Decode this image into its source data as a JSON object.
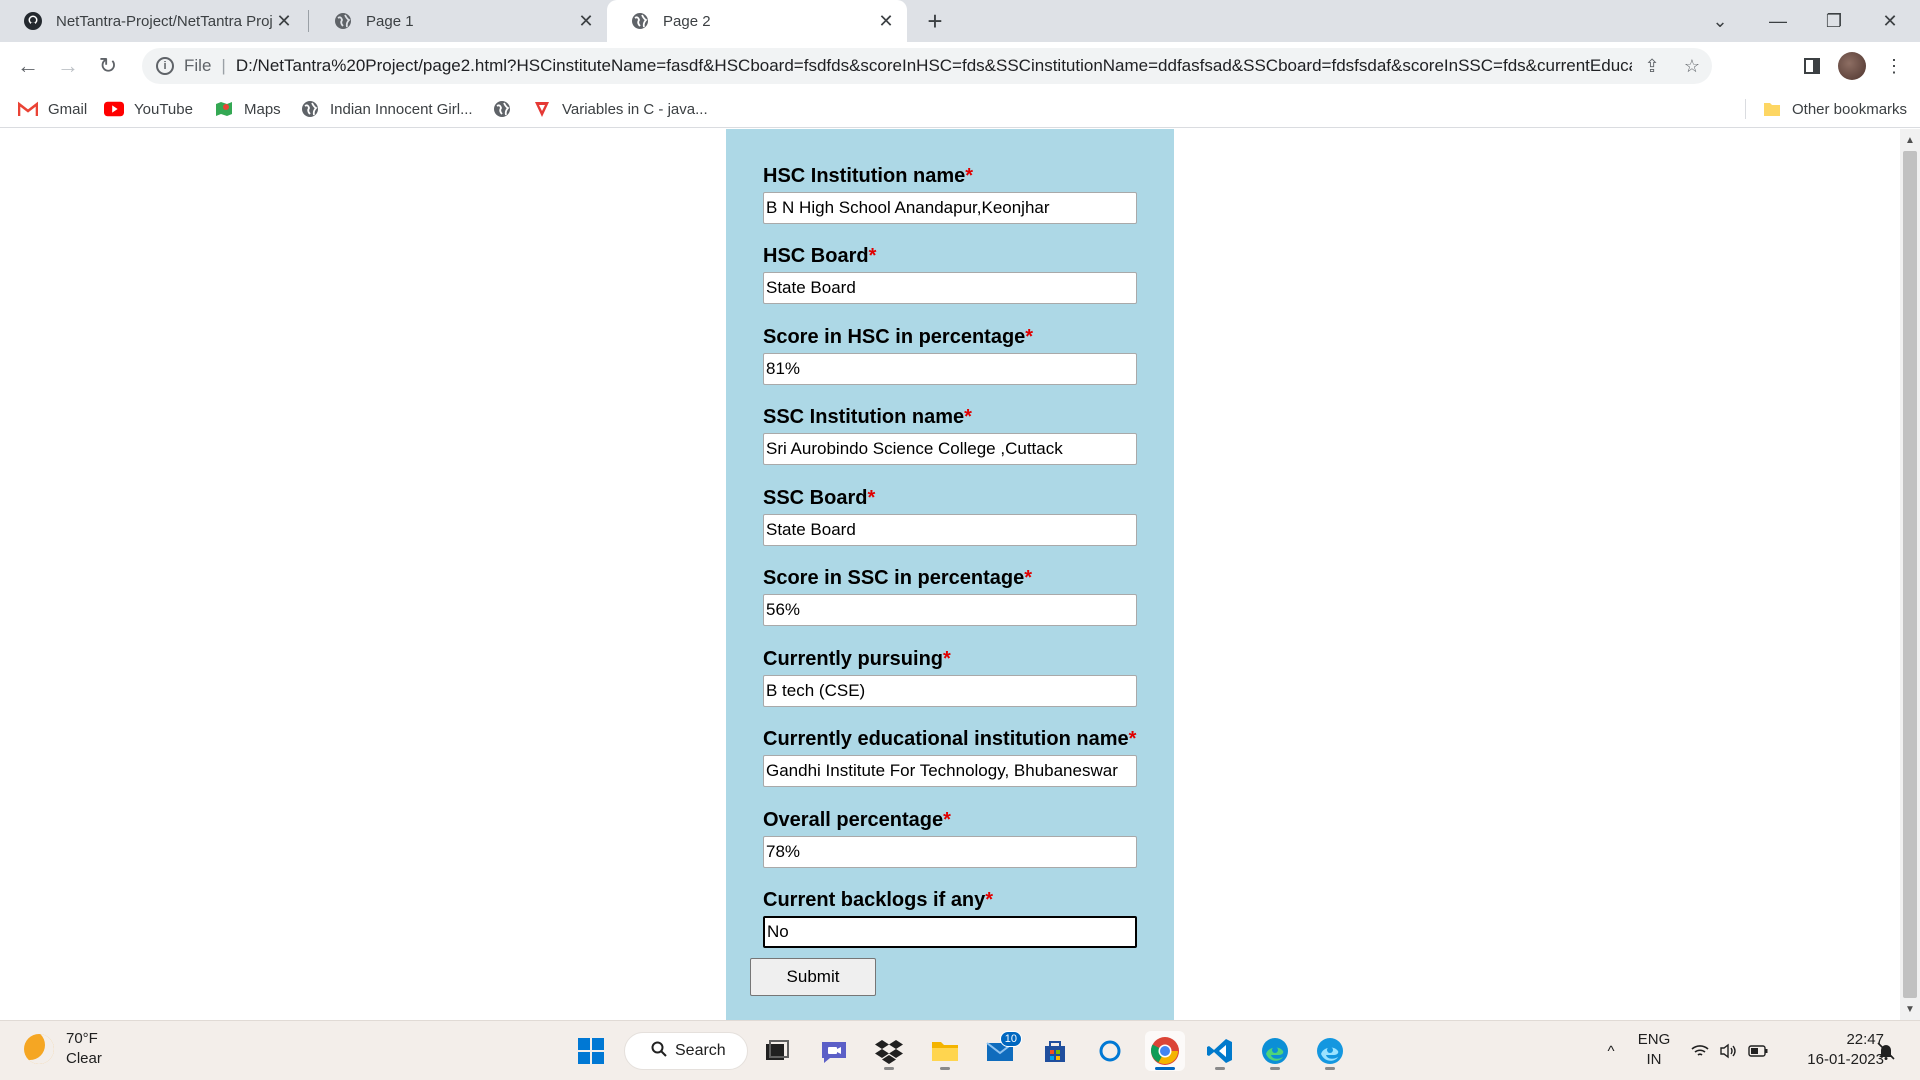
{
  "browser": {
    "tabs": [
      {
        "title": "NetTantra-Project/NetTantra Proj",
        "icon": "github-icon",
        "active": false
      },
      {
        "title": "Page 1",
        "icon": "globe-icon",
        "active": false
      },
      {
        "title": "Page 2",
        "icon": "globe-icon",
        "active": true
      }
    ],
    "address": {
      "scheme": "File",
      "url": "D:/NetTantra%20Project/page2.html?HSCinstituteName=fasdf&HSCboard=fsdfds&scoreInHSC=fds&SSCinstitutionName=ddfasfsad&SSCboard=fdsfsdaf&scoreInSSC=fds&currentEducatio..."
    },
    "bookmarks": [
      {
        "label": "Gmail",
        "icon": "gmail-icon"
      },
      {
        "label": "YouTube",
        "icon": "youtube-icon"
      },
      {
        "label": "Maps",
        "icon": "maps-icon"
      },
      {
        "label": "Indian Innocent Girl...",
        "icon": "globe-icon"
      },
      {
        "label": "",
        "icon": "globe-icon"
      },
      {
        "label": "Variables in C - java...",
        "icon": "javatpoint-icon"
      }
    ],
    "other_bookmarks": "Other bookmarks"
  },
  "form": {
    "required_marker": "*",
    "fields": [
      {
        "label": "HSC Institution name",
        "value": "B N High School Anandapur,Keonjhar"
      },
      {
        "label": "HSC Board",
        "value": "State Board"
      },
      {
        "label": "Score in HSC in percentage",
        "value": "81%"
      },
      {
        "label": "SSC Institution name",
        "value": "Sri Aurobindo Science College ,Cuttack"
      },
      {
        "label": "SSC Board",
        "value": "State Board"
      },
      {
        "label": "Score in SSC in percentage",
        "value": "56%"
      },
      {
        "label": "Currently pursuing",
        "value": "B tech (CSE)"
      },
      {
        "label": "Currently educational institution name",
        "value": "Gandhi Institute For Technology, Bhubaneswar"
      },
      {
        "label": "Overall percentage",
        "value": "78%"
      },
      {
        "label": "Current backlogs if any",
        "value": "No"
      }
    ],
    "submit_label": "Submit"
  },
  "taskbar": {
    "weather": {
      "temp": "70°F",
      "condition": "Clear"
    },
    "search_label": "Search",
    "mail_badge": "10",
    "language": {
      "line1": "ENG",
      "line2": "IN"
    },
    "clock": {
      "time": "22:47",
      "date": "16-01-2023"
    }
  },
  "colors": {
    "panel_bg": "#add8e6",
    "required": "#e00000",
    "tab_strip": "#dee1e6",
    "taskbar": "#f3eeea"
  }
}
